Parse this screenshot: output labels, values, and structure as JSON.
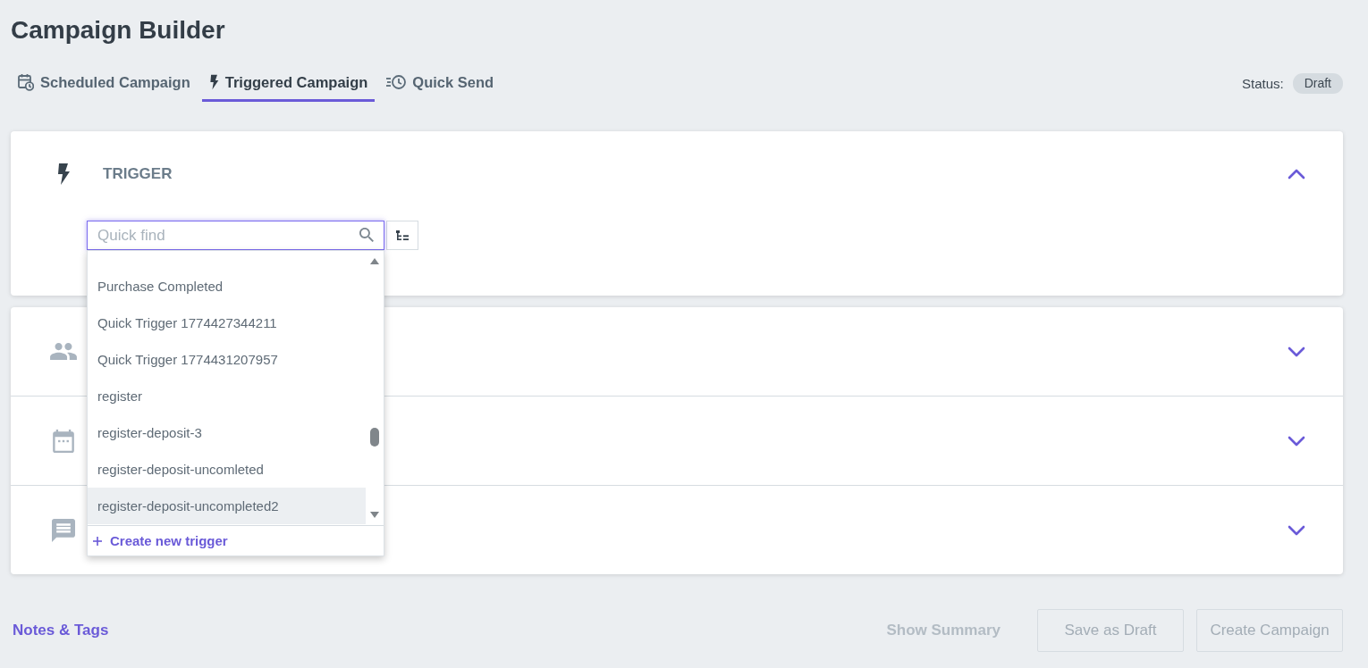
{
  "page": {
    "title": "Campaign Builder"
  },
  "tabs": [
    {
      "label": "Scheduled Campaign",
      "kind": "scheduled",
      "selected": false
    },
    {
      "label": "Triggered Campaign",
      "kind": "triggered",
      "selected": true
    },
    {
      "label": "Quick Send",
      "kind": "quick",
      "selected": false
    }
  ],
  "status": {
    "label": "Status:",
    "value": "Draft"
  },
  "sections": [
    {
      "kind": "trigger",
      "title": "TRIGGER",
      "expanded": true,
      "search": {
        "placeholder": "Quick find",
        "items": [
          {
            "label": "Purchase Completed",
            "selected": false
          },
          {
            "label": "Quick Trigger 1774427344211",
            "selected": false
          },
          {
            "label": "Quick Trigger 1774431207957",
            "selected": false
          },
          {
            "label": "register",
            "selected": false
          },
          {
            "label": "register-deposit-3",
            "selected": false
          },
          {
            "label": "register-deposit-uncomleted",
            "selected": false
          },
          {
            "label": "register-deposit-uncompleted2",
            "selected": true
          }
        ],
        "create_label": "Create new trigger"
      }
    },
    {
      "kind": "audience",
      "expanded": false
    },
    {
      "kind": "schedule",
      "expanded": false
    },
    {
      "kind": "message",
      "expanded": false
    }
  ],
  "footer": {
    "notes_link": "Notes & Tags",
    "buttons": [
      {
        "label": "Show Summary",
        "kind": "text",
        "disabled": true
      },
      {
        "label": "Save as Draft",
        "kind": "outlined",
        "disabled": true
      },
      {
        "label": "Create Campaign",
        "kind": "outlined",
        "disabled": true
      }
    ]
  }
}
